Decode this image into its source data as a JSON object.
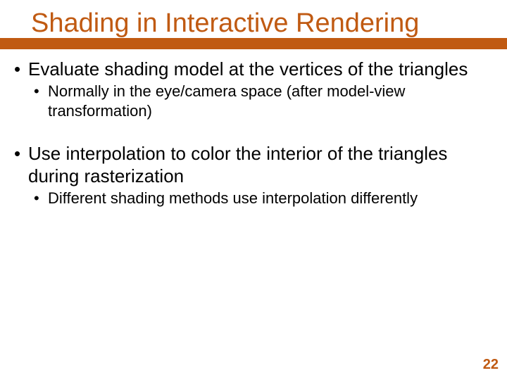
{
  "title": "Shading in Interactive Rendering",
  "bullets": {
    "b1": "Evaluate shading model at the vertices of the triangles",
    "b1_1": "Normally in the eye/camera space (after model-view transformation)",
    "b2": "Use interpolation to color the interior of the triangles during rasterization",
    "b2_1": "Different shading methods use interpolation differently"
  },
  "page_number": "22"
}
